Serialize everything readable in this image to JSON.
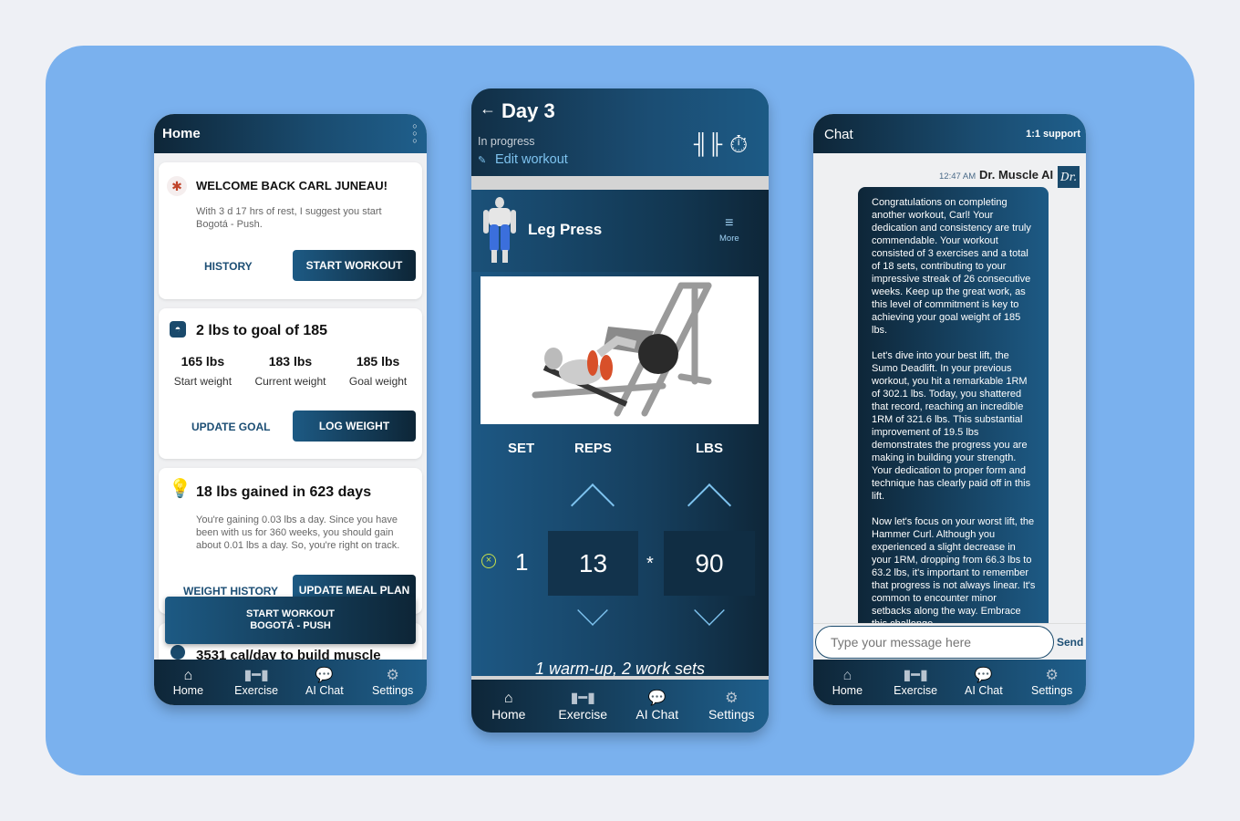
{
  "home": {
    "title": "Home",
    "welcome": {
      "title": "WELCOME BACK CARL JUNEAU!",
      "text": "With 3 d 17 hrs of rest, I suggest you start Bogotá - Push.",
      "history": "HISTORY",
      "start": "START WORKOUT"
    },
    "goal": {
      "title": "2 lbs to goal of 185",
      "stats": [
        {
          "value": "165 lbs",
          "label": "Start weight"
        },
        {
          "value": "183 lbs",
          "label": "Current weight"
        },
        {
          "value": "185 lbs",
          "label": "Goal weight"
        }
      ],
      "update": "UPDATE GOAL",
      "log": "LOG WEIGHT"
    },
    "gain": {
      "title": "18 lbs gained in 623 days",
      "text": "You're gaining 0.03 lbs a day. Since you have been with us for 360 weeks, you should gain about 0.01 lbs a day. So, you're right on track.",
      "history": "WEIGHT HISTORY",
      "meal": "UPDATE MEAL PLAN"
    },
    "floating": {
      "line1": "START WORKOUT",
      "line2": "BOGOTÁ - PUSH"
    },
    "calories": "3531 cal/day to build muscle"
  },
  "nav": [
    {
      "label": "Home",
      "icon": "home-icon"
    },
    {
      "label": "Exercise",
      "icon": "dumbbell-icon"
    },
    {
      "label": "AI Chat",
      "icon": "chat-icon"
    },
    {
      "label": "Settings",
      "icon": "gear-icon"
    }
  ],
  "workout": {
    "title": "Day 3",
    "status": "In progress",
    "edit": "Edit workout",
    "exercise": "Leg Press",
    "more": "More",
    "headers": {
      "set": "SET",
      "reps": "REPS",
      "lbs": "LBS"
    },
    "set": "1",
    "reps": "13",
    "times": "*",
    "lbs": "90",
    "summary": "1 warm-up, 2 work sets"
  },
  "chat": {
    "title": "Chat",
    "support": "1:1 support",
    "time": "12:47 AM",
    "sender": "Dr. Muscle AI",
    "avatar": "Dr.",
    "paragraphs": [
      "Congratulations on completing another workout, Carl! Your dedication and consistency are truly commendable. Your workout consisted of 3 exercises and a total of 18 sets, contributing to your impressive streak of 26 consecutive weeks. Keep up the great work, as this level of commitment is key to achieving your goal weight of 185 lbs.",
      "Let's dive into your best lift, the Sumo Deadlift. In your previous workout, you hit a remarkable 1RM of 302.1 lbs. Today, you shattered that record, reaching an incredible 1RM of 321.6 lbs. This substantial improvement of 19.5 lbs demonstrates the progress you are making in building your strength. Your dedication to proper form and technique has clearly paid off in this lift.",
      "Now let's focus on your worst lift, the Hammer Curl. Although you experienced a slight decrease in your 1RM, dropping from 66.3 lbs to 63.2 lbs, it's important to remember that progress is not always linear. It's common to encounter minor setbacks along the way. Embrace this challenge"
    ],
    "placeholder": "Type your message here",
    "send": "Send"
  },
  "colors": {
    "panel": "#7ab1ee",
    "dark": "#0e2638",
    "accent": "#1f5f8c",
    "link": "#7ec3ef"
  }
}
